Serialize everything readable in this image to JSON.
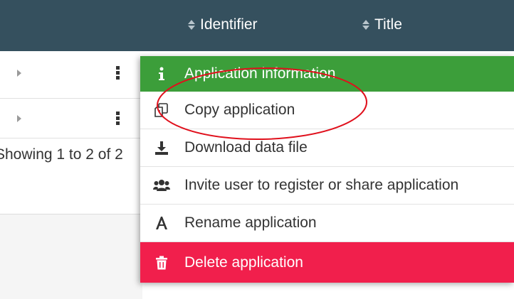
{
  "table": {
    "columns": [
      {
        "label": "Identifier"
      },
      {
        "label": "Title"
      }
    ],
    "footer_text": "Showing 1 to 2 of 2"
  },
  "menu": {
    "items": [
      {
        "label": "Application information",
        "icon": "info-icon",
        "color": "#3c9e3a"
      },
      {
        "label": "Copy application",
        "icon": "copy-icon"
      },
      {
        "label": "Download data file",
        "icon": "download-icon"
      },
      {
        "label": "Invite user to register or share application",
        "icon": "users-icon"
      },
      {
        "label": "Rename application",
        "icon": "rename-icon"
      },
      {
        "label": "Delete application",
        "icon": "trash-icon",
        "color": "#f11f4c"
      }
    ]
  },
  "colors": {
    "header_bg": "#35505e",
    "annotation": "#e0101c"
  }
}
